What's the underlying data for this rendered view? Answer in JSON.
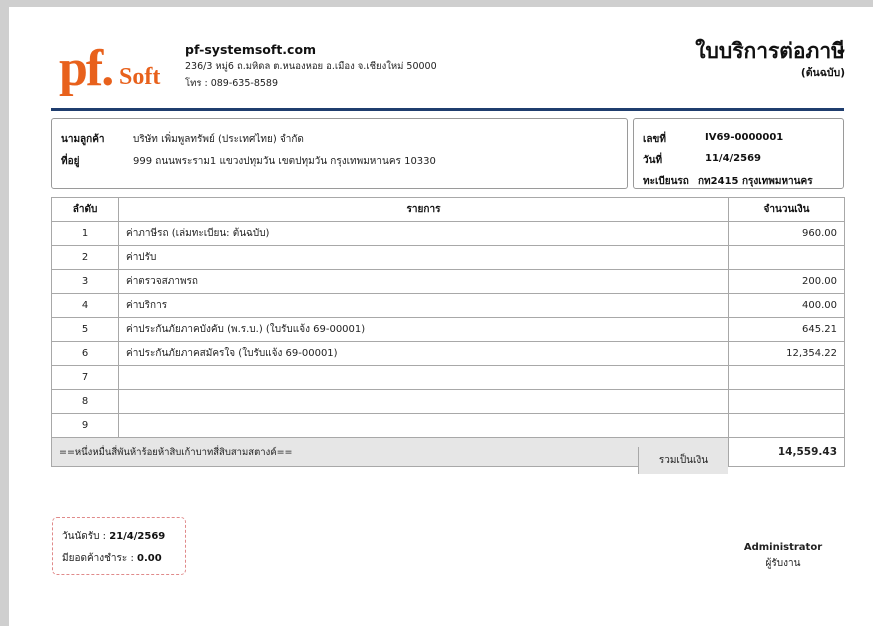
{
  "company": {
    "logo_main": "pf.",
    "logo_sub": "Soft",
    "name": "pf-systemsoft.com",
    "address": "236/3 หมู่6 ถ.มหิดล ต.หนองหอย อ.เมือง จ.เชียงใหม่ 50000",
    "phone": "โทร : 089-635-8589"
  },
  "document": {
    "title": "ใบบริการต่อภาษี",
    "copy_label": "(ต้นฉบับ)",
    "number_label": "เลขที่",
    "number": "IV69-0000001",
    "date_label": "วันที่",
    "date": "11/4/2569",
    "plate_label": "ทะเบียนรถ",
    "plate": "กท2415 กรุงเทพมหานคร"
  },
  "customer": {
    "name_label": "นามลูกค้า",
    "name": "บริษัท เพิ่มพูลทรัพย์ (ประเทศไทย) จำกัด",
    "address_label": "ที่อยู่",
    "address": "999 ถนนพระราม1 แขวงปทุมวัน เขตปทุมวัน กรุงเทพมหานคร 10330"
  },
  "table": {
    "headers": [
      "ลำดับ",
      "รายการ",
      "จำนวนเงิน"
    ],
    "rows": [
      {
        "no": "1",
        "desc": "ค่าภาษีรถ (เล่มทะเบียน: ต้นฉบับ)",
        "amount": "960.00"
      },
      {
        "no": "2",
        "desc": "ค่าปรับ",
        "amount": ""
      },
      {
        "no": "3",
        "desc": "ค่าตรวจสภาพรถ",
        "amount": "200.00"
      },
      {
        "no": "4",
        "desc": "ค่าบริการ",
        "amount": "400.00"
      },
      {
        "no": "5",
        "desc": "ค่าประกันภัยภาคบังคับ (พ.ร.บ.) (ใบรับแจ้ง 69-00001)",
        "amount": "645.21"
      },
      {
        "no": "6",
        "desc": "ค่าประกันภัยภาคสมัครใจ (ใบรับแจ้ง 69-00001)",
        "amount": "12,354.22"
      },
      {
        "no": "7",
        "desc": "",
        "amount": ""
      },
      {
        "no": "8",
        "desc": "",
        "amount": ""
      },
      {
        "no": "9",
        "desc": "",
        "amount": ""
      }
    ],
    "amount_in_words": "==หนึ่งหมื่นสี่พันห้าร้อยห้าสิบเก้าบาทสี่สิบสามสตางค์==",
    "total_label": "รวมเป็นเงิน",
    "total": "14,559.43"
  },
  "appointment": {
    "date_label": "วันนัดรับ : ",
    "date": "21/4/2569",
    "balance_label": "มียอดค้างชำระ : ",
    "balance": "0.00"
  },
  "signature": {
    "name": "Administrator",
    "role": "ผู้รับงาน"
  },
  "colors": {
    "logo": "#e8611c",
    "rule": "#1f3d6e",
    "appointment_border": "#e08a8a"
  }
}
